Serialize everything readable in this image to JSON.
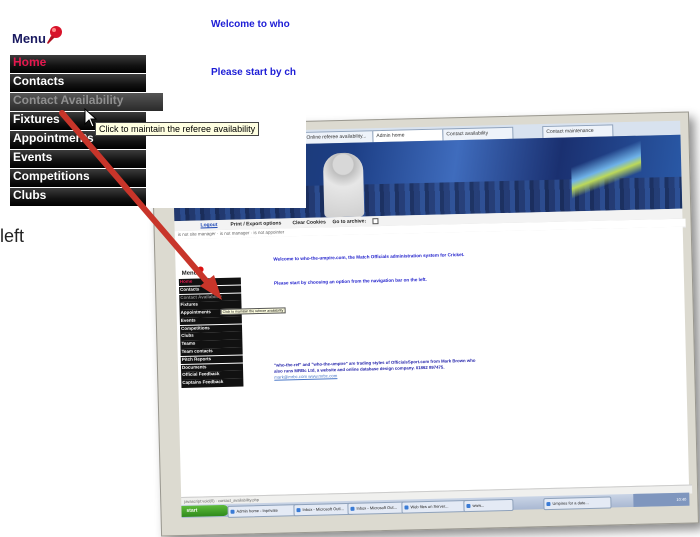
{
  "inset": {
    "menu_label": "Menu",
    "nav_items": [
      {
        "label": "Home",
        "state": "active"
      },
      {
        "label": "Contacts",
        "state": "normal"
      },
      {
        "label": "Contact Availability",
        "state": "hover"
      },
      {
        "label": "Fixtures",
        "state": "normal"
      },
      {
        "label": "Appointments",
        "state": "normal"
      },
      {
        "label": "Events",
        "state": "normal"
      },
      {
        "label": "Competitions",
        "state": "normal"
      },
      {
        "label": "Clubs",
        "state": "normal"
      }
    ],
    "welcome_text": "Welcome to who",
    "start_text": "Please start by ch",
    "tooltip": "Click to maintain the referee availability"
  },
  "left_fragment": "left",
  "screenshot": {
    "tabs": [
      "Online referee availability...",
      "Admin home",
      "Contact availability",
      "Contact maintenance"
    ],
    "toolbar": [
      "Logout",
      "Print / Export options",
      "Clear Cookies",
      "Go to archive:"
    ],
    "breadcrumb": "is not site manager · is not manager · is not appointer",
    "menu_label": "Menu",
    "nav_items": [
      {
        "label": "Home",
        "state": "active"
      },
      {
        "label": "Contacts",
        "state": "normal"
      },
      {
        "label": "Contact Availability",
        "state": "hover"
      },
      {
        "label": "Fixtures",
        "state": "normal"
      },
      {
        "label": "Appointments",
        "state": "normal"
      },
      {
        "label": "Events",
        "state": "normal"
      },
      {
        "label": "Competitions",
        "state": "normal"
      },
      {
        "label": "Clubs",
        "state": "normal"
      },
      {
        "label": "Teams",
        "state": "normal"
      },
      {
        "label": "Team contacts",
        "state": "normal"
      },
      {
        "label": "Pitch Reports",
        "state": "normal"
      },
      {
        "label": "Documents",
        "state": "normal"
      },
      {
        "label": "Official Feedback",
        "state": "normal"
      },
      {
        "label": "Captains Feedback",
        "state": "normal"
      }
    ],
    "tooltip": "Click to maintain the referee availability",
    "welcome_text": "Welcome to who-the-umpire.com, the Match Officials administration system for Cricket.",
    "start_text": "Please start by choosing an option from the navigation bar on the left.",
    "footer_text": "\"who-the-ref\" and \"who-the-umpire\" are trading styles of OfficialsSport.com from Mark Brown who also runs MRBc Ltd, a website and online database design company. 01862 897475.",
    "footer_links": "mark@mrbc.com  www.mrbc.com",
    "status_text": "javascript:void(0) · contact_availability.php",
    "taskbar": {
      "start": "start",
      "tasks": [
        "Admin home - Inprivate",
        "Inbox - Microsoft Outl...",
        "Inbox - Microsoft Out...",
        "Web files on Server...",
        "www...",
        "Umpires for a date..."
      ],
      "clock": "10:40"
    }
  },
  "colors": {
    "nav_bg": "#111111",
    "nav_active": "#e4184e",
    "nav_dim": "#8f8f8f",
    "link_blue": "#1d1dd6",
    "arrow": "#c8352a",
    "tooltip_bg": "#ffffe1"
  }
}
